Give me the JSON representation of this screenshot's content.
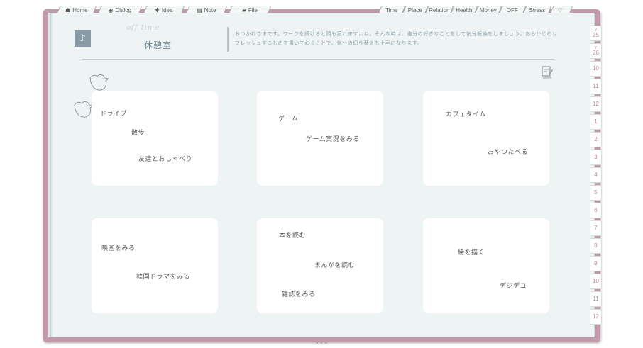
{
  "tabs_left": [
    {
      "label": "Home",
      "icon": "home-icon"
    },
    {
      "label": "Dialog",
      "icon": "dialog-icon"
    },
    {
      "label": "Idea",
      "icon": "lightbulb-icon"
    },
    {
      "label": "Note",
      "icon": "clipboard-icon"
    },
    {
      "label": "File",
      "icon": "folder-icon"
    }
  ],
  "tabs_right": [
    "Time",
    "Place",
    "Relation",
    "Health",
    "Money",
    "OFF",
    "Stress",
    ""
  ],
  "header": {
    "badge_glyph": "♪",
    "script_title": "off time",
    "title": "休憩室",
    "description": "おつかれさまです。ワークを続けると頭も疲れますよね。そんな時は、自分の好きなことをして気分転換をしましょう。あらかじめリフレッシュするものを書いておくことで、気分の切り替えも上手になります。"
  },
  "cards": [
    {
      "items": [
        "ドライブ",
        "散歩",
        "友達とおしゃべり"
      ]
    },
    {
      "items": [
        "ゲーム",
        "ゲーム実況をみる"
      ]
    },
    {
      "items": [
        "カフェタイム",
        "おやつたべる"
      ]
    },
    {
      "items": [
        "映画をみる",
        "韓国ドラマをみる"
      ]
    },
    {
      "items": [
        "本を読む",
        "まんがを読む",
        "雑誌をみる"
      ]
    },
    {
      "items": [
        "絵を描く",
        "デジデコ"
      ]
    }
  ],
  "index_tabs": [
    {
      "year": "Y",
      "label": "25"
    },
    {
      "year": "Y",
      "label": "26"
    },
    {
      "label": "10"
    },
    {
      "label": "11"
    },
    {
      "label": "12"
    },
    {
      "label": "1"
    },
    {
      "label": "2"
    },
    {
      "label": "3"
    },
    {
      "label": "4"
    },
    {
      "label": "5"
    },
    {
      "label": "6"
    },
    {
      "label": "7"
    },
    {
      "label": "8"
    },
    {
      "label": "9"
    },
    {
      "label": "10"
    },
    {
      "label": "11"
    },
    {
      "label": "12"
    }
  ],
  "footer": {
    "dots": "•••"
  }
}
